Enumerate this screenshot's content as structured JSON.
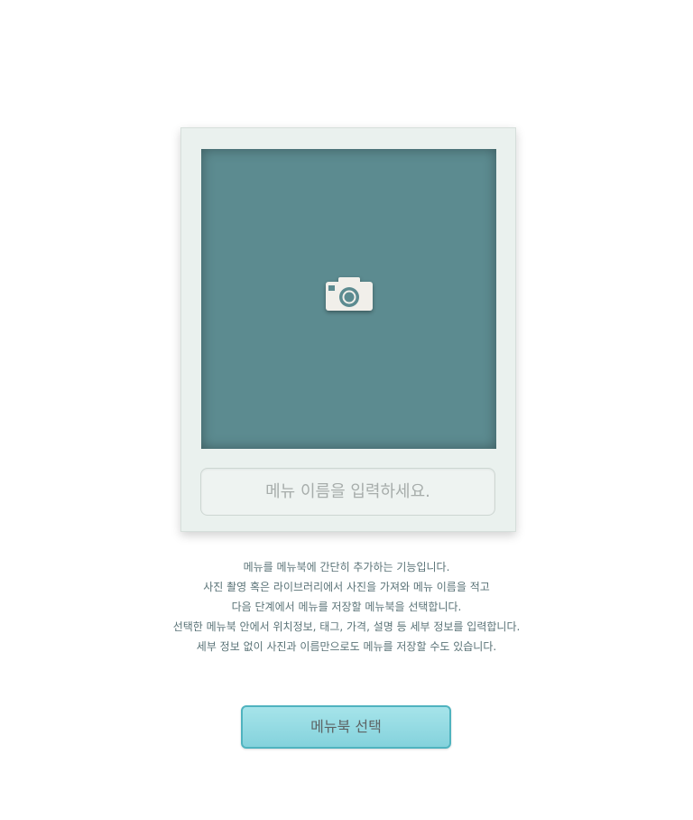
{
  "photo_card": {
    "camera_icon": "camera-icon",
    "photo_bg_color": "#5c8b90"
  },
  "menu_name": {
    "value": "",
    "placeholder": "메뉴 이름을 입력하세요."
  },
  "description": {
    "lines": [
      "메뉴를 메뉴북에 간단히 추가하는 기능입니다.",
      "사진 촬영 혹은 라이브러리에서 사진을 가져와 메뉴 이름을 적고",
      "다음 단계에서 메뉴를 저장할 메뉴북을 선택합니다.",
      "선택한 메뉴북 안에서 위치정보, 태그, 가격, 설명 등 세부 정보를 입력합니다.",
      "세부 정보 없이 사진과 이름만으로도 메뉴를 저장할 수도 있습니다."
    ]
  },
  "actions": {
    "select_menubook_label": "메뉴북 선택",
    "accent_color": "#4fb3bf"
  }
}
